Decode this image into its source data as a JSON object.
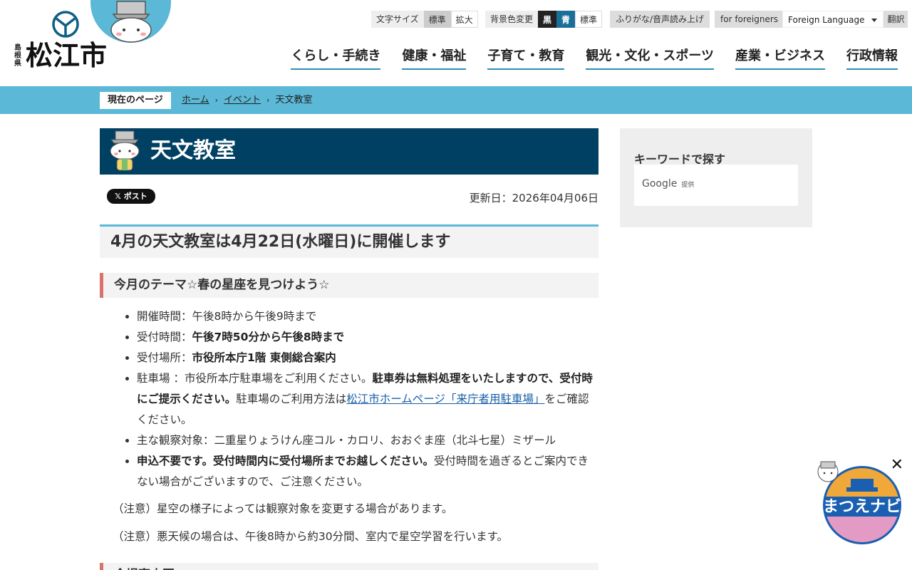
{
  "header": {
    "pref_name": "島根県",
    "city_name": "松江市",
    "util": {
      "font_size_label": "文字サイズ",
      "font_standard": "標準",
      "font_large": "拡大",
      "bg_label": "背景色変更",
      "bg_black": "黒",
      "bg_blue": "青",
      "bg_standard": "標準",
      "furigana": "ふりがな/音声読み上げ",
      "foreigners": "for foreigners",
      "language_select": "Foreign Language",
      "translate": "翻訳"
    },
    "nav": [
      "くらし・手続き",
      "健康・福祉",
      "子育て・教育",
      "観光・文化・スポーツ",
      "産業・ビジネス",
      "行政情報"
    ]
  },
  "breadcrumb": {
    "here_label": "現在のページ",
    "items": [
      "ホーム",
      "イベント",
      "天文教室"
    ],
    "separator": "›"
  },
  "main": {
    "page_title": "天文教室",
    "x_post": "𝕏 ポスト",
    "updated": "更新日：2026年04月06日",
    "heading": "4月の天文教室は4月22日(水曜日)に開催します",
    "section_heading": "今月のテーマ☆春の星座を見つけよう☆",
    "items": {
      "time_label": "開催時間：",
      "time_value": "午後8時から午後9時まで",
      "reception_label": "受付時間：",
      "reception_value": "午後7時50分から午後8時まで",
      "place_label": "受付場所：",
      "place_value": "市役所本庁1階 東側総合案内",
      "parking_label": "駐車場 ：",
      "parking_text": "市役所本庁駐車場をご利用ください。",
      "parking_bold": "駐車券は無料処理をいたしますので、受付時にご提示ください。",
      "parking_text2": "駐車場のご利用方法は",
      "parking_link": "松江市ホームページ「来庁者用駐車場」",
      "parking_text3": "をご確認ください。",
      "targets_label": "主な観察対象：",
      "targets_value": "二重星りょうけん座コル・カロリ、おおぐま座（北斗七星）ミザール",
      "apply_bold": "申込不要です。受付時間内に受付場所までお越しください。",
      "apply_text": "受付時間を過ぎるとご案内できない場合がございますので、ご注意ください。"
    },
    "note1": "（注意）星空の様子によっては観察対象を変更する場合があります。",
    "note2": "（注意）悪天候の場合は、午後8時から約30分間、室内で星空学習を行います。",
    "next_heading": "今場室内図"
  },
  "sidebar": {
    "keyword_title": "キーワードで探す",
    "google": "Google",
    "provided": "提供"
  },
  "navi": {
    "label": "まつえナビ",
    "close": "✕"
  },
  "colors": {
    "accent": "#5bb8d6",
    "title_bg": "#004163",
    "heading_bar": "#d9736a",
    "link": "#1a5fa8"
  }
}
